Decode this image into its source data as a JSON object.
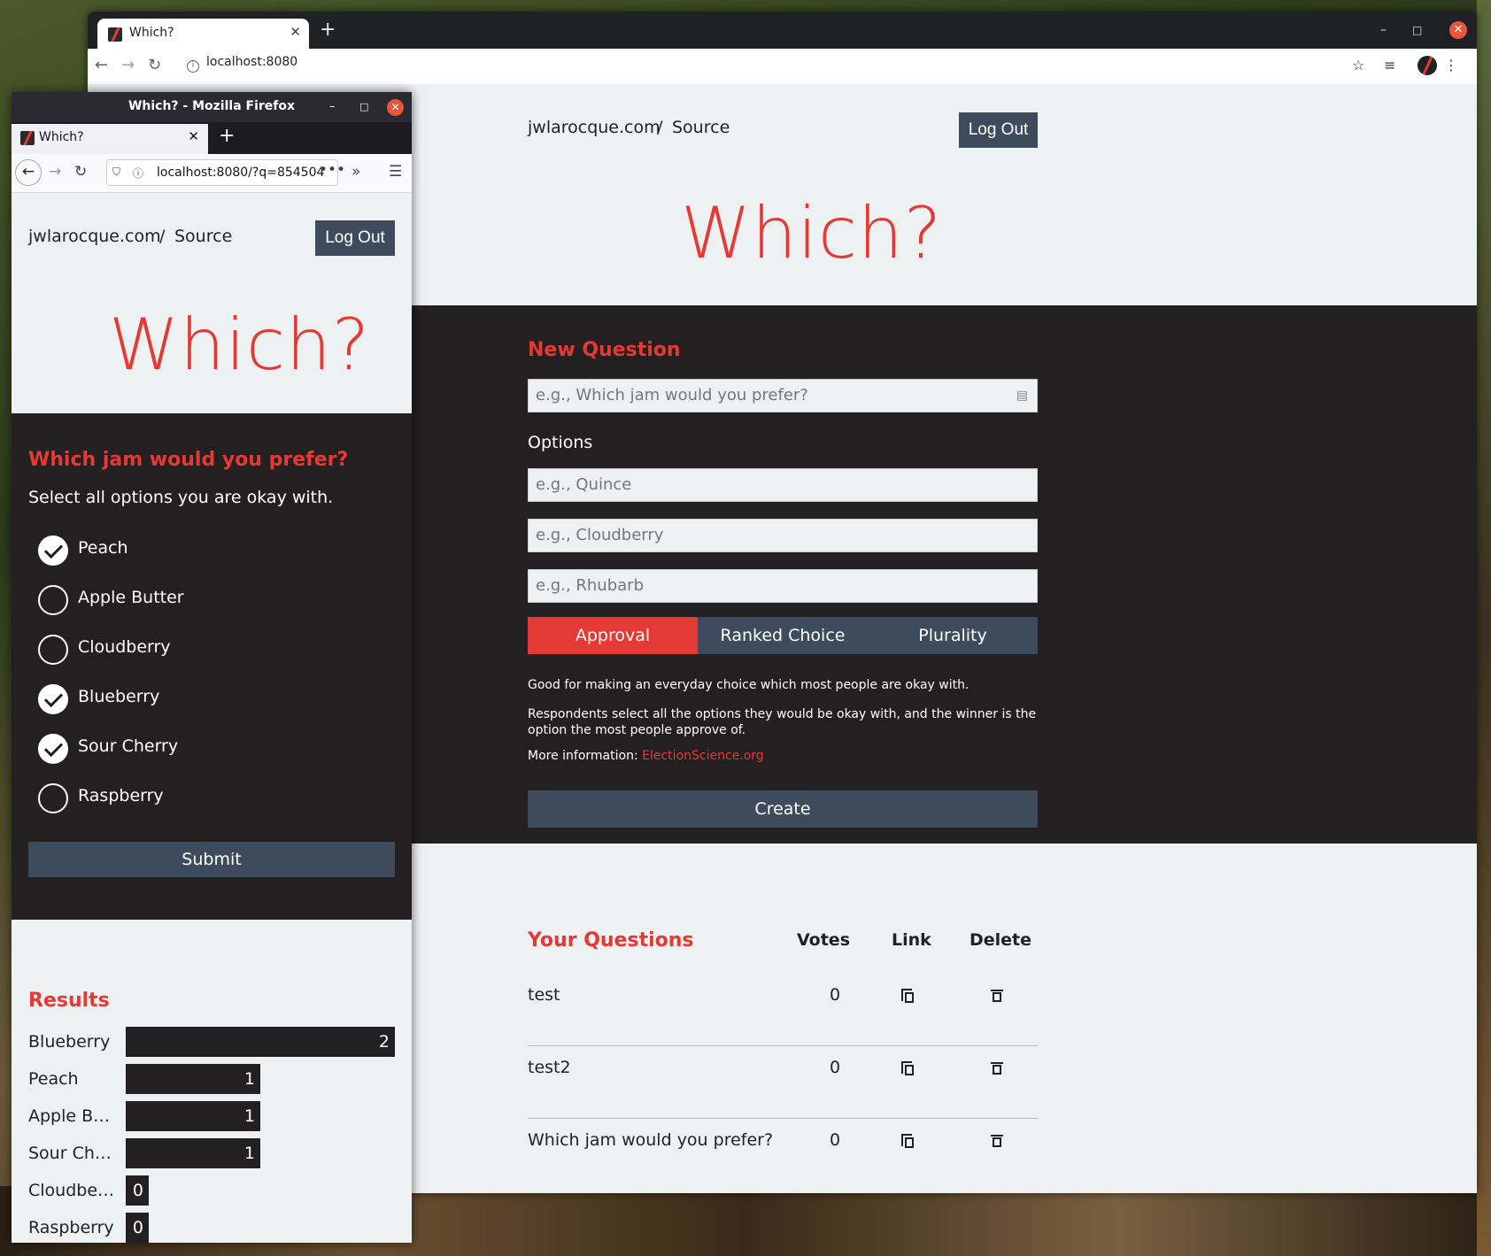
{
  "chrome": {
    "tab_title": "Which?",
    "url": "localhost:8080"
  },
  "firefox": {
    "window_title": "Which? - Mozilla Firefox",
    "tab_title": "Which?",
    "url": "localhost:8080/?q=854504"
  },
  "header": {
    "site_link": "jwlarocque.com",
    "separator": "/",
    "source_link": "Source",
    "logout_label": "Log Out",
    "app_title": "Which?"
  },
  "new_question": {
    "heading": "New Question",
    "question_placeholder": "e.g., Which jam would you prefer?",
    "options_label": "Options",
    "option_placeholders": [
      "e.g., Quince",
      "e.g., Cloudberry",
      "e.g., Rhubarb"
    ],
    "methods": [
      "Approval",
      "Ranked Choice",
      "Plurality"
    ],
    "active_method": "Approval",
    "desc_1": "Good for making an everyday choice which most people are okay with.",
    "desc_2": "Respondents select all the options they would be okay with, and the winner is the option the most people approve of.",
    "more_info_label": "More information:",
    "more_info_link": "ElectionScience.org",
    "create_label": "Create"
  },
  "your_questions": {
    "heading": "Your Questions",
    "col_votes": "Votes",
    "col_link": "Link",
    "col_delete": "Delete",
    "rows": [
      {
        "title": "test",
        "votes": "0"
      },
      {
        "title": "test2",
        "votes": "0"
      },
      {
        "title": "Which jam would you prefer?",
        "votes": "0"
      }
    ]
  },
  "ballot": {
    "question": "Which jam would you prefer?",
    "instruction": "Select all options you are okay with.",
    "options": [
      {
        "label": "Peach",
        "checked": true
      },
      {
        "label": "Apple Butter",
        "checked": false
      },
      {
        "label": "Cloudberry",
        "checked": false
      },
      {
        "label": "Blueberry",
        "checked": true
      },
      {
        "label": "Sour Cherry",
        "checked": true
      },
      {
        "label": "Raspberry",
        "checked": false
      }
    ],
    "submit_label": "Submit"
  },
  "results": {
    "heading": "Results",
    "max": 2,
    "rows": [
      {
        "label": "Blueberry",
        "value": 2
      },
      {
        "label": "Peach",
        "value": 1
      },
      {
        "label": "Apple Butter",
        "value": 1
      },
      {
        "label": "Sour Cherry",
        "value": 1
      },
      {
        "label": "Cloudberry",
        "value": 0
      },
      {
        "label": "Raspberry",
        "value": 0
      }
    ]
  },
  "colors": {
    "accent": "#e53935",
    "dark": "#232021",
    "slate": "#3d4b5c",
    "light": "#eef1f2"
  }
}
